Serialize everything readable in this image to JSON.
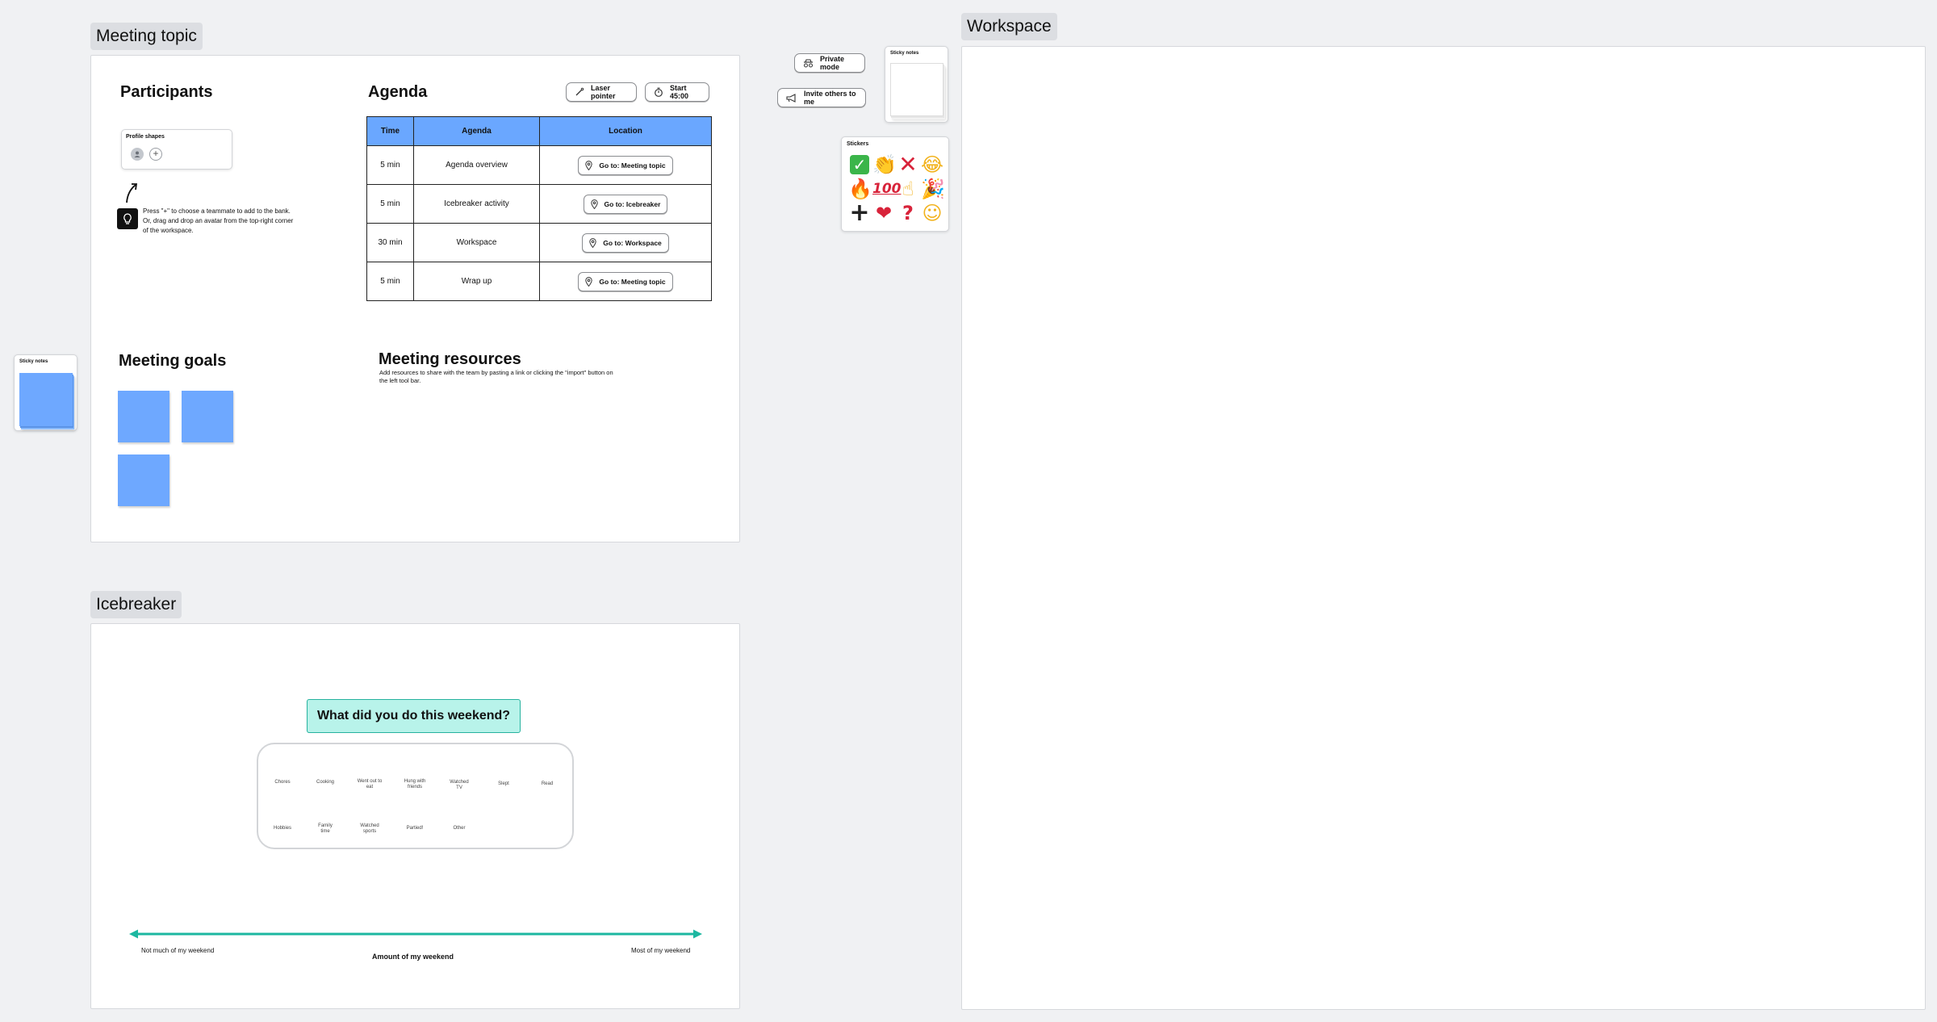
{
  "sections": {
    "meeting_topic": "Meeting topic",
    "icebreaker": "Icebreaker",
    "workspace": "Workspace"
  },
  "participants": {
    "title": "Participants",
    "profile_card_title": "Profile shapes",
    "hint": "Press \"+\" to choose a teammate to add to the bank. Or, drag and drop an avatar from the top-right corner of the workspace."
  },
  "agenda": {
    "title": "Agenda",
    "laser_label": "Laser pointer",
    "timer_label": "Start 45:00",
    "headers": [
      "Time",
      "Agenda",
      "Location"
    ],
    "rows": [
      {
        "time": "5 min",
        "item": "Agenda overview",
        "location": "Go to: Meeting topic"
      },
      {
        "time": "5 min",
        "item": "Icebreaker activity",
        "location": "Go to: Icebreaker"
      },
      {
        "time": "30 min",
        "item": "Workspace",
        "location": "Go to: Workspace"
      },
      {
        "time": "5 min",
        "item": "Wrap up",
        "location": "Go to: Meeting topic"
      }
    ]
  },
  "goals": {
    "title": "Meeting goals"
  },
  "resources": {
    "title": "Meeting resources",
    "text": "Add resources to share with the team by pasting a link or clicking the \"import\" button on the left tool bar."
  },
  "left_sticky_card": {
    "title": "Sticky notes"
  },
  "toolbar": {
    "private_mode": "Private mode",
    "invite": "Invite others to me",
    "sticky_title": "Sticky notes",
    "stickers_title": "Stickers",
    "stickers": [
      "white-check-mark",
      "clapping-hands",
      "red-x",
      "tears-of-joy",
      "fire",
      "hundred-points",
      "pointing-up",
      "party-popper",
      "plus",
      "red-heart",
      "red-question-mark",
      "slightly-smiling-face"
    ]
  },
  "icebreaker": {
    "question": "What did you do this weekend?",
    "categories_row1": [
      "Chores",
      "Cooking",
      "Went out to eat",
      "Hung with friends",
      "Watched TV",
      "Slept",
      "Read"
    ],
    "categories_row2": [
      "Hobbies",
      "Family time",
      "Watched sports",
      "Partied!",
      "Other"
    ],
    "scale_left": "Not much of my weekend",
    "scale_right": "Most of my weekend",
    "scale_label": "Amount of my weekend"
  },
  "colors": {
    "accent_blue": "#6aa7ff",
    "question_bg": "#b8f3ea",
    "question_border": "#27b39f",
    "scale_line": "#1cb7a0"
  }
}
